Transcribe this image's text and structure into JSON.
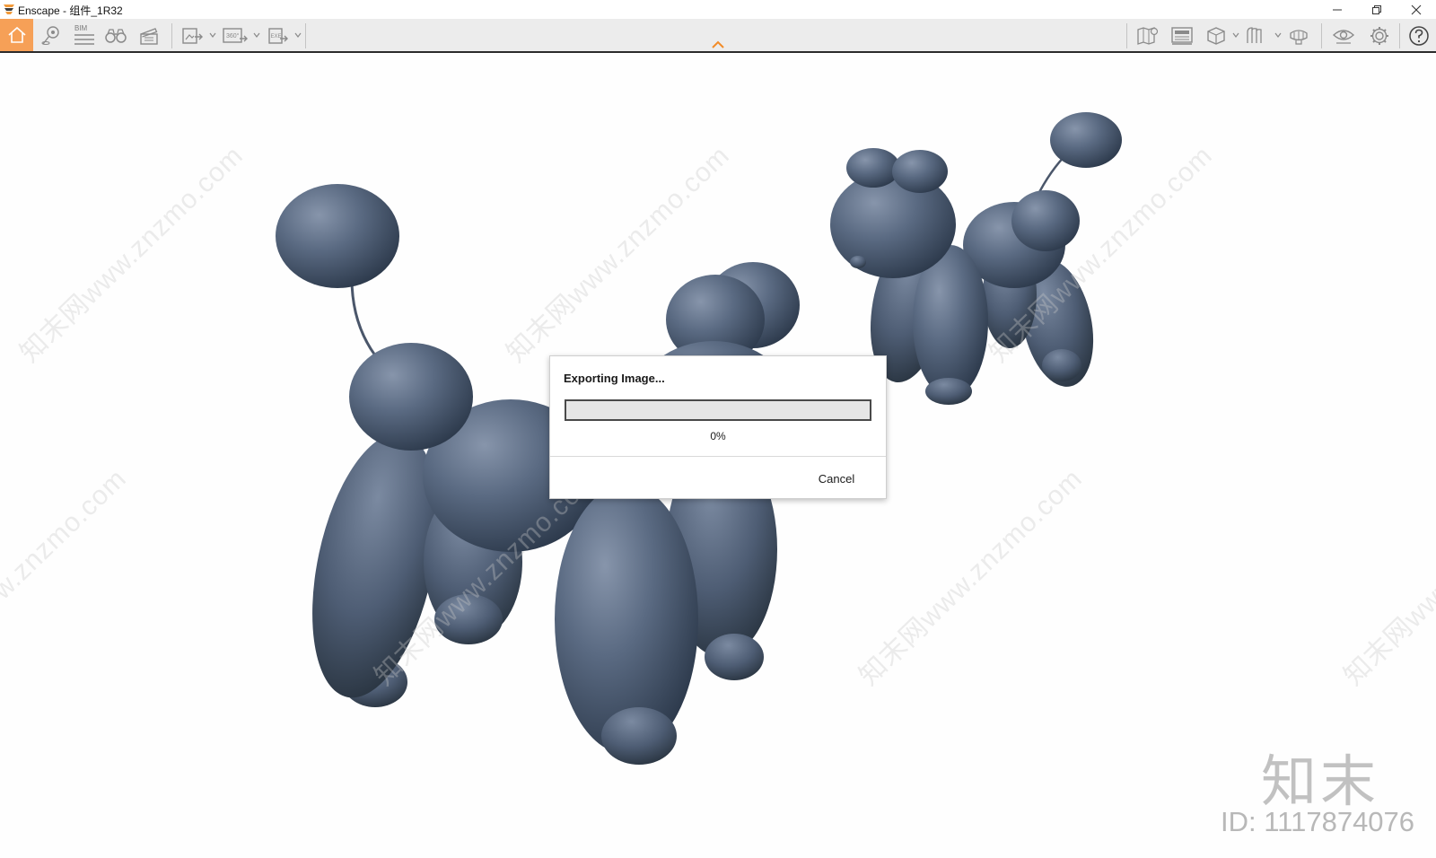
{
  "window": {
    "title": "Enscape - 组件_1R32",
    "controls": [
      "minimize",
      "restore",
      "close"
    ]
  },
  "toolbar": {
    "left_tools": [
      {
        "icon": "home-icon",
        "active": true
      },
      {
        "icon": "location-pin-icon"
      },
      {
        "icon": "bim-icon",
        "label": "BIM"
      },
      {
        "icon": "binoculars-icon"
      },
      {
        "icon": "clapperboard-icon"
      },
      {
        "icon": "render-export-icon",
        "has_dropdown": true
      },
      {
        "icon": "panorama-360-icon",
        "label": "360°",
        "has_dropdown": true
      },
      {
        "icon": "exe-export-icon",
        "label": "EXE",
        "has_dropdown": true
      }
    ],
    "right_tools": [
      {
        "icon": "map-icon"
      },
      {
        "icon": "material-editor-icon"
      },
      {
        "icon": "asset-library-icon",
        "has_dropdown": true
      },
      {
        "icon": "view-management-icon",
        "has_dropdown": true
      },
      {
        "icon": "capture-icon"
      },
      {
        "icon": "visual-settings-eye-icon"
      },
      {
        "icon": "settings-gear-icon"
      },
      {
        "icon": "help-icon"
      }
    ],
    "accent_color": "#f6a057"
  },
  "dialog": {
    "title": "Exporting Image...",
    "progress": 0,
    "progress_text": "0%",
    "cancel_label": "Cancel"
  },
  "watermark": {
    "text": "知末网www.znzmo.com",
    "brand": "知末",
    "id_text": "ID: 1117874076"
  },
  "scene": {
    "subject": "balloon-dog-sculptures",
    "balloon_color": "#4d5d74"
  }
}
